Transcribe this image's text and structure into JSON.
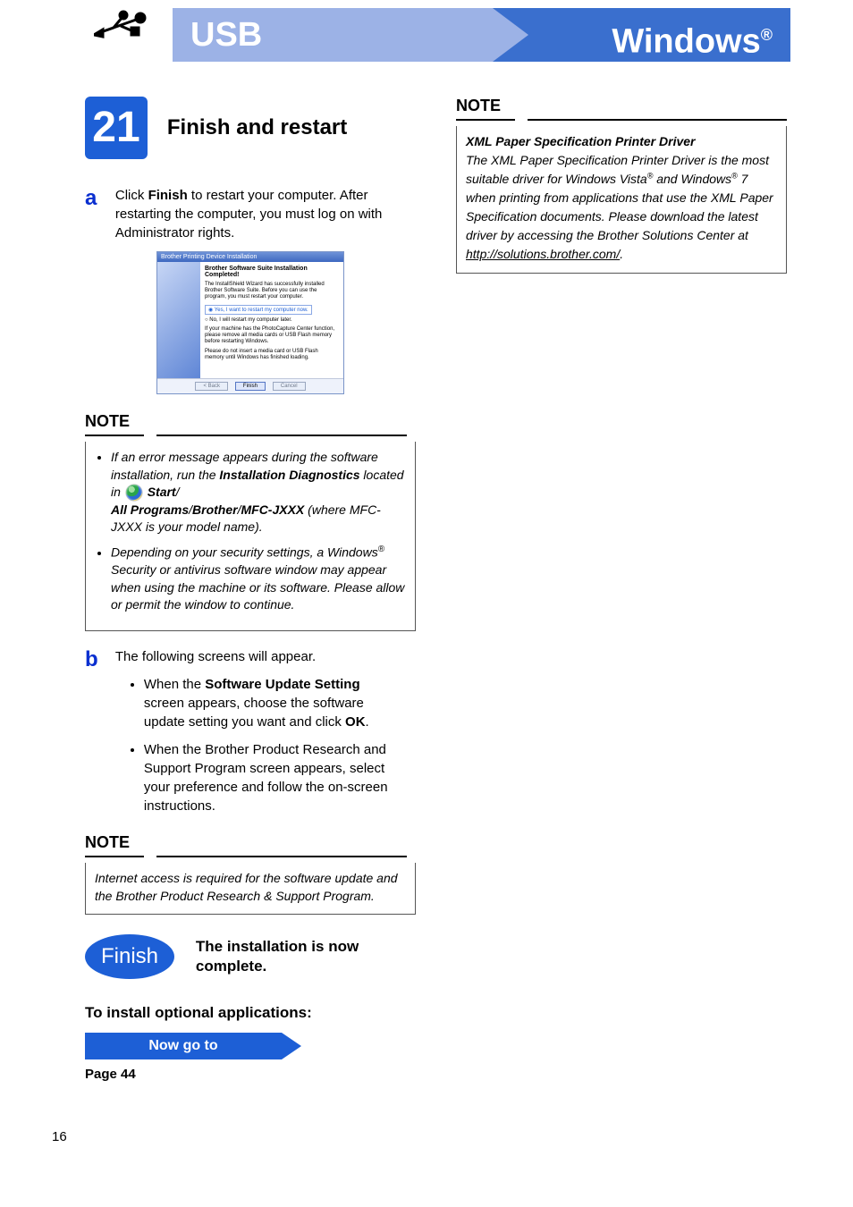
{
  "header": {
    "usb_label": "USB",
    "os_label": "Windows",
    "os_reg": "®"
  },
  "step": {
    "number": "21",
    "title": "Finish and restart"
  },
  "sub_a": {
    "letter": "a",
    "text_pre": "Click ",
    "text_bold": "Finish",
    "text_post": " to restart your computer. After restarting the computer, you must log on with Administrator rights."
  },
  "dialog": {
    "titlebar": "Brother Printing Device Installation",
    "heading": "Brother Software Suite Installation Completed!",
    "body1": "The InstallShield Wizard has successfully installed Brother Software Suite. Before you can use the program, you must restart your computer.",
    "radio1": "Yes, I want to restart my computer now.",
    "radio2": "No, I will restart my computer later.",
    "body2": "If your machine has the PhotoCapture Center function, please remove all media cards or USB Flash memory before restarting Windows.",
    "body3": "Please do not insert a media card or USB Flash memory until Windows has finished loading.",
    "btn_back": "< Back",
    "btn_finish": "Finish",
    "btn_cancel": "Cancel"
  },
  "note1": {
    "label": "NOTE",
    "bullet1_pre": "If an error message appears during the software installation, run the ",
    "bullet1_bold1": "Installation Diagnostics",
    "bullet1_mid": " located in ",
    "bullet1_bold2": "Start",
    "bullet1_slash": "/",
    "bullet1_bold3": "All Programs",
    "bullet1_bold4": "Brother",
    "bullet1_bold5": "MFC-JXXX",
    "bullet1_post": " (where MFC-JXXX is your model name).",
    "bullet2_pre": "Depending on your security settings, a Windows",
    "bullet2_reg": "®",
    "bullet2_post": " Security or antivirus software window may appear when using the machine or its software. Please allow or permit the window to continue."
  },
  "sub_b": {
    "letter": "b",
    "intro": "The following screens will appear.",
    "bullet1_pre": "When the ",
    "bullet1_bold1": "Software Update Setting",
    "bullet1_mid": " screen appears, choose the software update setting you want and click ",
    "bullet1_bold2": "OK",
    "bullet1_post": ".",
    "bullet2": "When the Brother Product Research and Support Program screen appears, select your preference and follow the on-screen instructions."
  },
  "note2": {
    "label": "NOTE",
    "text": "Internet access is required for the software update and the Brother Product Research & Support Program."
  },
  "finish": {
    "oval": "Finish",
    "text": "The installation is now complete."
  },
  "optional": {
    "heading": "To install optional applications:",
    "goto": "Now go to",
    "page": "Page 44"
  },
  "note_right": {
    "label": "NOTE",
    "title": "XML Paper Specification Printer Driver",
    "body_1": "The XML Paper Specification Printer Driver is the most suitable driver for Windows Vista",
    "reg": "®",
    "body_2": " and Windows",
    "body_3": " 7 when printing from applications that use the XML Paper Specification documents. Please download the latest driver by accessing the Brother Solutions Center at ",
    "link": "http://solutions.brother.com/",
    "body_4": "."
  },
  "page_number": "16"
}
